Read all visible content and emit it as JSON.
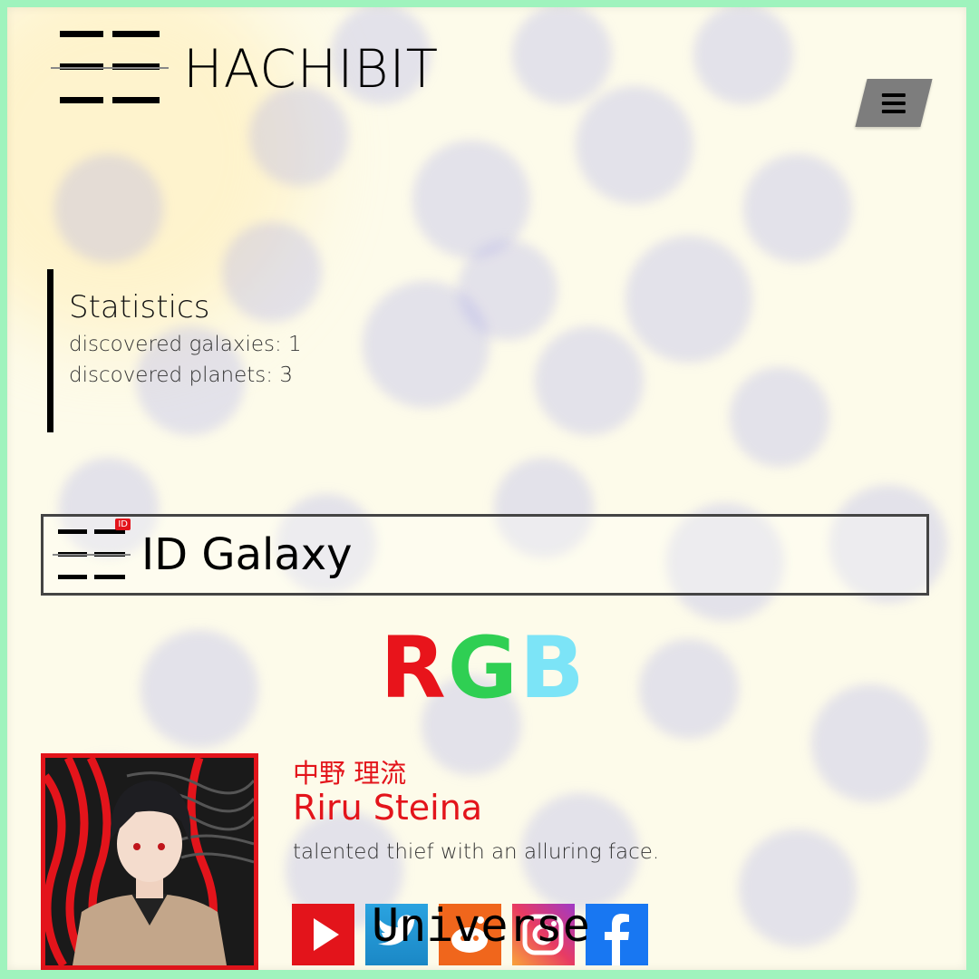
{
  "header": {
    "logo_text": "HACHIBIT",
    "menu_icon": "hamburger-menu-icon"
  },
  "statistics": {
    "title": "Statistics",
    "lines": [
      "discovered galaxies: 1",
      "discovered planets: 3"
    ]
  },
  "galaxy": {
    "badge": "ID",
    "label": "ID Galaxy"
  },
  "rgb": {
    "letters": [
      "R",
      "G",
      "B"
    ],
    "colors": [
      "#e8141b",
      "#2fcf53",
      "#7ce4f7"
    ]
  },
  "profile": {
    "name_jp": "中野 理流",
    "name_en": "Riru Steina",
    "description": "talented thief with an alluring face.",
    "social_icons": [
      "youtube-icon",
      "twitter-icon",
      "reddit-icon",
      "instagram-icon",
      "facebook-icon"
    ],
    "overlay_text": "Universe"
  },
  "colors": {
    "accent_red": "#e3141b",
    "frame_green": "#9ff3bd",
    "menu_gray": "#7d7d7d"
  }
}
